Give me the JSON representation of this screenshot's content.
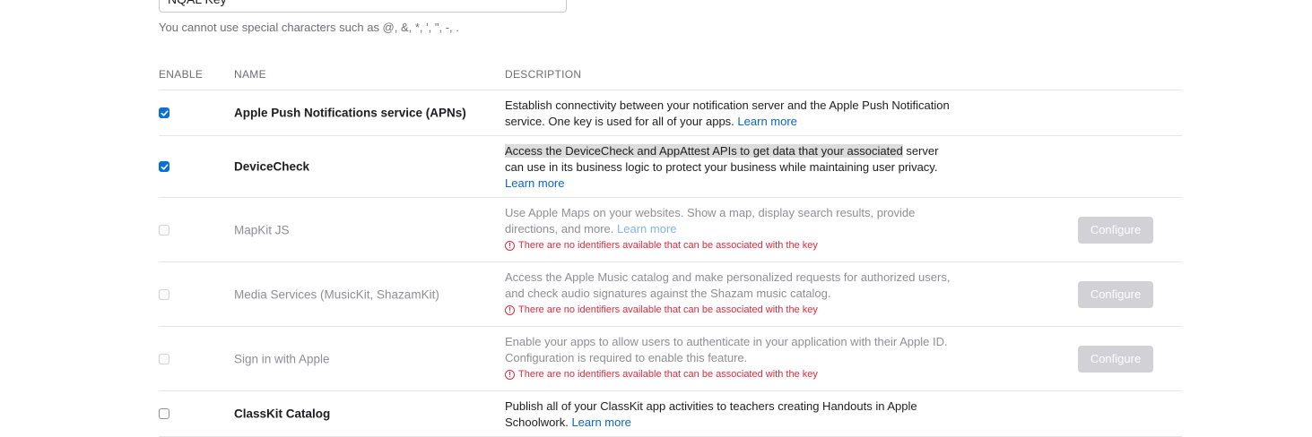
{
  "key_name_input": {
    "value": "NQAL Key"
  },
  "hint": "You cannot use special characters such as @, &, *, ', \", -, .",
  "table": {
    "headers": {
      "enable": "ENABLE",
      "name": "NAME",
      "description": "DESCRIPTION"
    },
    "rows": [
      {
        "name": "Apple Push Notifications service (APNs)",
        "checked": true,
        "disabled": false,
        "description": "Establish connectivity between your notification server and the Apple Push Notification service. One key is used for all of your apps.",
        "link": "Learn more"
      },
      {
        "name": "DeviceCheck",
        "checked": true,
        "disabled": false,
        "description_highlight": "Access the DeviceCheck and AppAttest APIs to get data that your associated",
        "description": " server can use in its business logic to protect your business while maintaining user privacy.",
        "link": "Learn more"
      },
      {
        "name": "MapKit JS",
        "checked": false,
        "disabled": true,
        "description": "Use Apple Maps on your websites. Show a map, display search results, provide directions, and more.",
        "link": "Learn more",
        "error": "There are no identifiers available that can be associated with the key",
        "button": "Configure"
      },
      {
        "name": "Media Services (MusicKit, ShazamKit)",
        "checked": false,
        "disabled": true,
        "description": "Access the Apple Music catalog and make personalized requests for authorized users, and check audio signatures against the Shazam music catalog.",
        "error": "There are no identifiers available that can be associated with the key",
        "button": "Configure"
      },
      {
        "name": "Sign in with Apple",
        "checked": false,
        "disabled": true,
        "description": "Enable your apps to allow users to authenticate in your application with their Apple ID. Configuration is required to enable this feature.",
        "error": "There are no identifiers available that can be associated with the key",
        "button": "Configure"
      },
      {
        "name": "ClassKit Catalog",
        "checked": false,
        "disabled": false,
        "description": "Publish all of your ClassKit app activities to teachers creating Handouts in Apple Schoolwork.",
        "link": "Learn more"
      }
    ]
  },
  "colors": {
    "accent": "#0a6fd6",
    "link": "#0a66c2",
    "error": "#e0293f",
    "disabled_button": "#d1d1d6"
  },
  "icons": {
    "checkmark": "checkmark-icon",
    "error": "error-circle-icon"
  }
}
